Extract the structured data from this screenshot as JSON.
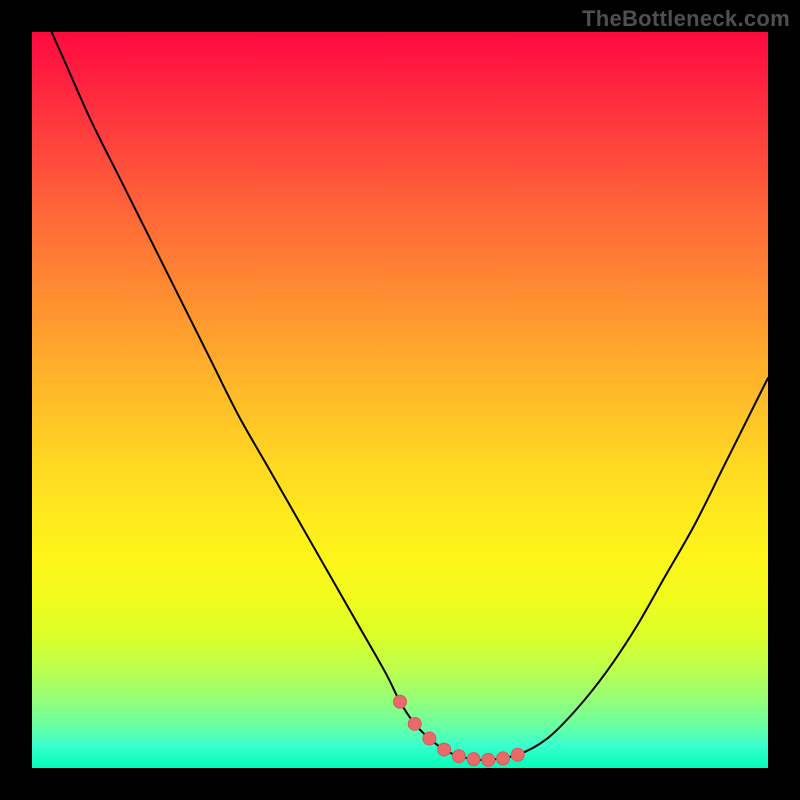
{
  "watermark": "TheBottleneck.com",
  "colors": {
    "frame_bg": "#000000",
    "curve_stroke": "#000000",
    "marker_fill": "#e86a6a",
    "marker_stroke": "#d65b5b"
  },
  "chart_data": {
    "type": "line",
    "title": "",
    "xlabel": "",
    "ylabel": "",
    "xlim": [
      0,
      100
    ],
    "ylim": [
      0,
      100
    ],
    "series": [
      {
        "name": "bottleneck-curve",
        "x": [
          0,
          4,
          8,
          12,
          16,
          20,
          24,
          28,
          32,
          36,
          40,
          44,
          48,
          50,
          52,
          54,
          56,
          58,
          60,
          62,
          66,
          70,
          74,
          78,
          82,
          86,
          90,
          94,
          98,
          100
        ],
        "values": [
          106,
          97,
          88,
          80,
          72,
          64,
          56,
          48,
          41,
          34,
          27,
          20,
          13,
          9,
          6,
          4,
          2.5,
          1.6,
          1.2,
          1.1,
          1.8,
          4,
          8,
          13,
          19,
          26,
          33,
          41,
          49,
          53
        ]
      }
    ],
    "markers": {
      "name": "optimal-zone-markers",
      "x": [
        50,
        52,
        54,
        56,
        58,
        60,
        62,
        64,
        66
      ],
      "values": [
        9,
        6,
        4,
        2.5,
        1.6,
        1.2,
        1.1,
        1.3,
        1.8
      ]
    }
  }
}
